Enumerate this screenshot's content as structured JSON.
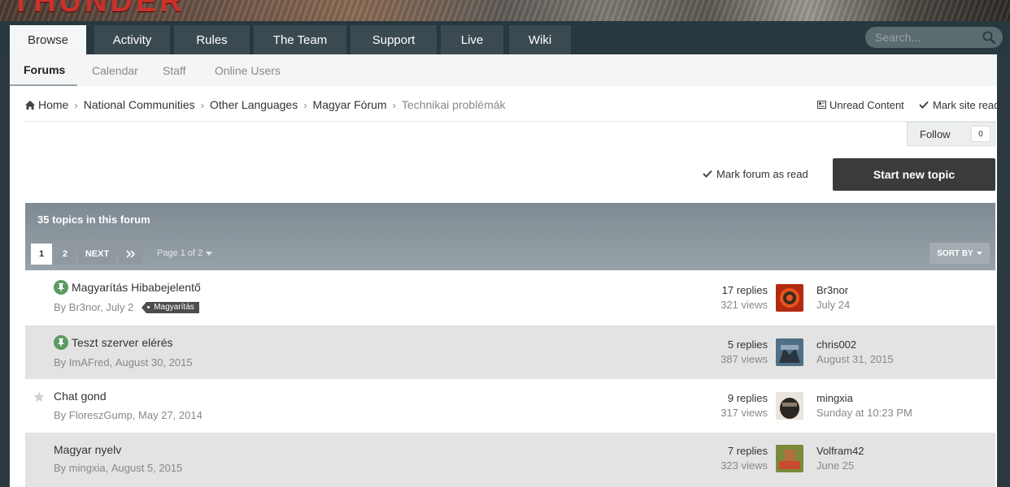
{
  "brand": {
    "logo_text": "THUNDER"
  },
  "mainnav": {
    "tabs": [
      {
        "label": "Browse",
        "active": true
      },
      {
        "label": "Activity"
      },
      {
        "label": "Rules"
      },
      {
        "label": "The Team"
      },
      {
        "label": "Support"
      },
      {
        "label": "Live"
      },
      {
        "label": "Wiki"
      }
    ],
    "search_placeholder": "Search..."
  },
  "subnav": {
    "items": [
      "Forums",
      "Calendar",
      "Staff",
      "Online Users"
    ]
  },
  "breadcrumb": {
    "items": [
      "Home",
      "National Communities",
      "Other Languages",
      "Magyar Fórum"
    ],
    "current": "Technikai problémák"
  },
  "toplinks": {
    "unread": "Unread Content",
    "mark_site": "Mark site read"
  },
  "follow": {
    "label": "Follow",
    "count": "0"
  },
  "actions": {
    "mark_forum": "Mark forum as read",
    "start_topic": "Start new topic"
  },
  "forum": {
    "topic_count": "35 topics in this forum",
    "pagination": {
      "pages": [
        "1",
        "2"
      ],
      "next": "NEXT",
      "page_of": "Page 1 of 2"
    },
    "sort_by": "SORT BY"
  },
  "topics": [
    {
      "title": "Magyarítás Hibabejelentő",
      "author": "By Br3nor,",
      "date": "July 2",
      "tag": "Magyarítás",
      "pinned": true,
      "replies": "17 replies",
      "views": "321 views",
      "last_user": "Br3nor",
      "last_date": "July 24"
    },
    {
      "title": "Teszt szerver elérés",
      "author": "By ImAFred,",
      "date": "August 30, 2015",
      "pinned": true,
      "replies": "5 replies",
      "views": "387 views",
      "last_user": "chris002",
      "last_date": "August 31, 2015"
    },
    {
      "title": "Chat gond",
      "author": "By FloreszGump,",
      "date": "May 27, 2014",
      "pinned": false,
      "replies": "9 replies",
      "views": "317 views",
      "last_user": "mingxia",
      "last_date": "Sunday at 10:23 PM"
    },
    {
      "title": "Magyar nyelv",
      "author": "By mingxia,",
      "date": "August 5, 2015",
      "pinned": false,
      "replies": "7 replies",
      "views": "323 views",
      "last_user": "Volfram42",
      "last_date": "June 25"
    }
  ],
  "colors": {
    "nav_bg": "#28383f",
    "tab_bg": "#3a4a50",
    "header_grey": "#8b959c",
    "pin_green": "#5a9b63",
    "button_dark": "#393b3d"
  }
}
